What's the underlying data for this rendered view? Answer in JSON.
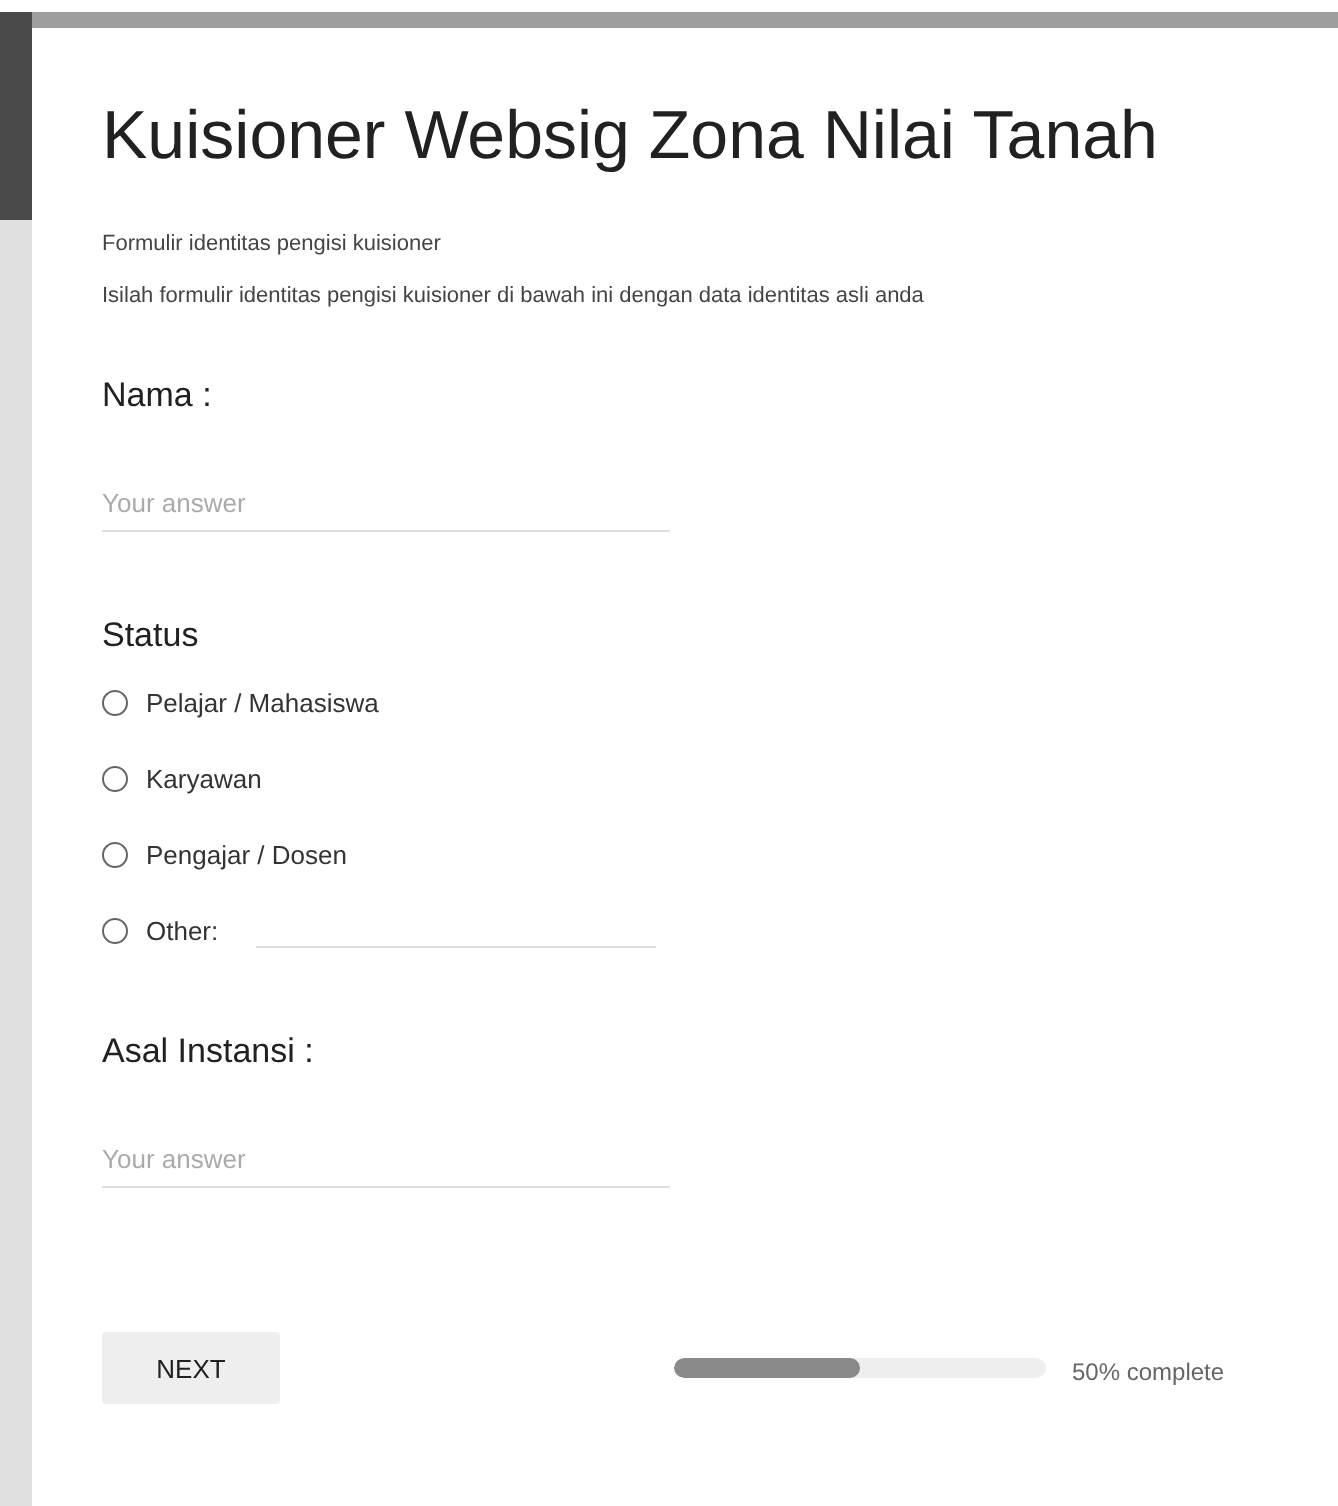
{
  "form": {
    "title": "Kuisioner Websig Zona Nilai Tanah",
    "section_title": "Formulir identitas pengisi kuisioner",
    "section_description": "Isilah formulir identitas pengisi kuisioner di bawah ini dengan data identitas asli anda"
  },
  "questions": [
    {
      "kind": "text",
      "label": "Nama :",
      "placeholder": "Your answer"
    },
    {
      "kind": "radio",
      "label": "Status",
      "options": [
        {
          "label": "Pelajar / Mahasiswa",
          "selected": false,
          "kind": "option"
        },
        {
          "label": "Karyawan",
          "selected": false,
          "kind": "option"
        },
        {
          "label": "Pengajar / Dosen",
          "selected": false,
          "kind": "option"
        },
        {
          "label": "Other:",
          "selected": false,
          "kind": "other"
        }
      ]
    },
    {
      "kind": "text",
      "label": "Asal Instansi :",
      "placeholder": "Your answer"
    }
  ],
  "footer": {
    "button": "NEXT",
    "progress": {
      "level": 0.5,
      "reading": "50% complete"
    }
  }
}
